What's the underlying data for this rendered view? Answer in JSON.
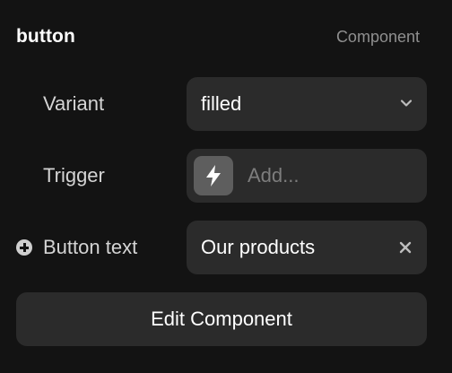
{
  "header": {
    "title": "button",
    "type_label": "Component"
  },
  "properties": {
    "variant": {
      "label": "Variant",
      "value": "filled",
      "icon": "chevron-down-icon"
    },
    "trigger": {
      "label": "Trigger",
      "placeholder": "Add...",
      "icon": "lightning-bolt-icon"
    },
    "button_text": {
      "label": "Button text",
      "value": "Our products",
      "leading_icon": "plus-circle-icon",
      "clear_icon": "close-icon"
    }
  },
  "actions": {
    "edit_label": "Edit Component"
  },
  "colors": {
    "background": "#131313",
    "field": "#2b2b2b",
    "bolt_box": "#5e5e5e",
    "muted_text": "#8f8f8f",
    "placeholder_text": "#7d7d7d"
  }
}
